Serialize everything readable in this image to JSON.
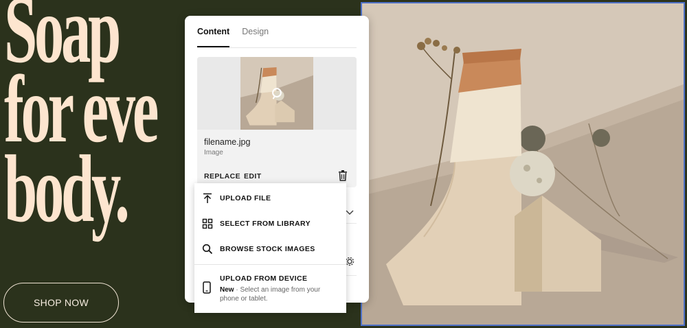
{
  "hero": {
    "headline_line1": "Soap",
    "headline_line2": "for eve",
    "headline_line3": "body.",
    "cta_label": "SHOP NOW"
  },
  "panel": {
    "tabs": [
      {
        "label": "Content",
        "active": true
      },
      {
        "label": "Design",
        "active": false
      }
    ],
    "media": {
      "filename": "filename.jpg",
      "type_label": "Image",
      "replace_label": "REPLACE",
      "edit_label": "EDIT"
    }
  },
  "menu": {
    "items": [
      {
        "label": "UPLOAD FILE",
        "icon": "upload-icon"
      },
      {
        "label": "SELECT FROM LIBRARY",
        "icon": "grid-icon"
      },
      {
        "label": "BROWSE STOCK IMAGES",
        "icon": "search-icon"
      }
    ],
    "device": {
      "label": "UPLOAD FROM DEVICE",
      "badge": "New",
      "description": " · Select an image from your phone or tablet.",
      "icon": "phone-icon"
    }
  },
  "colors": {
    "hero_bg": "#2b321c",
    "headline": "#fde5cf",
    "selection_border": "#4f72c9"
  }
}
